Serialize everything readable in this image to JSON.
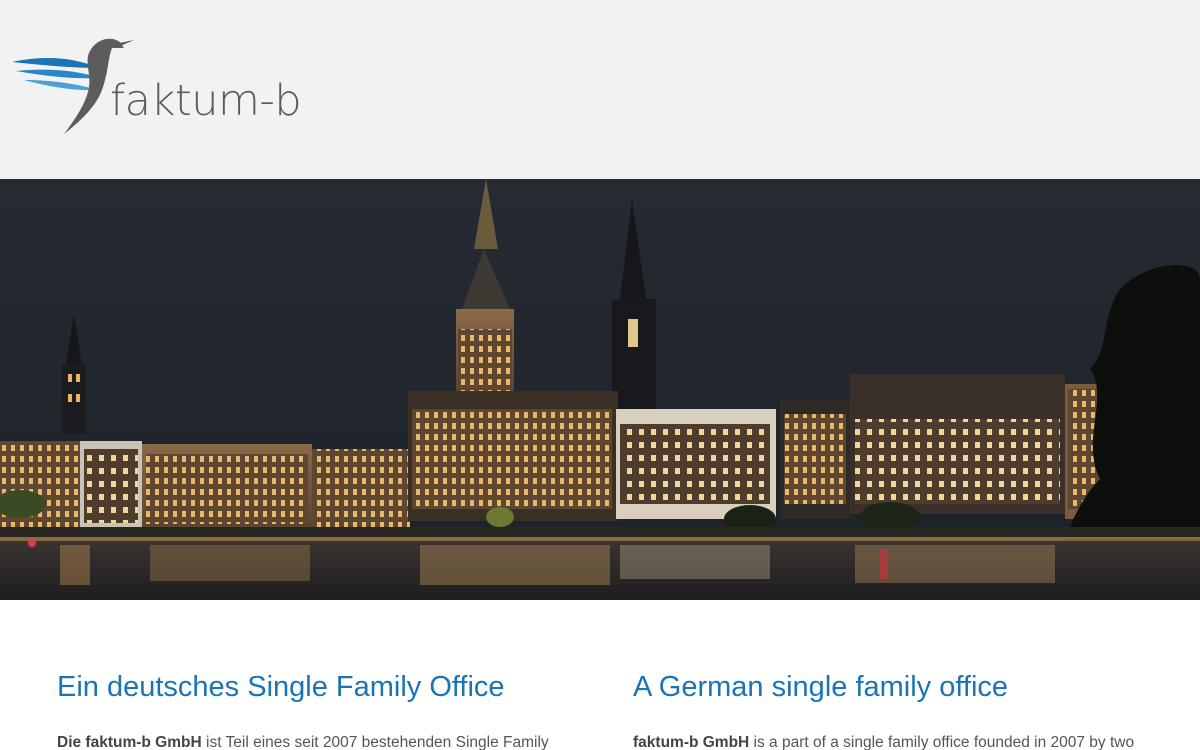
{
  "header": {
    "logo": {
      "icon": "hummingbird-logo-icon",
      "text": "faktum-b",
      "colors": {
        "wing": "#1a74b5",
        "body": "#5c5c5c"
      }
    }
  },
  "hero": {
    "image": "hamburg-night-skyline-photo"
  },
  "content": {
    "left": {
      "heading": "Ein deutsches Single Family Office",
      "text_bold": "Die faktum-b GmbH",
      "text": " ist Teil eines seit 2007 bestehenden Single Family"
    },
    "right": {
      "heading": "A German single family office",
      "text_bold": "faktum-b GmbH",
      "text": " is a part of a single family office founded in 2007 by two"
    }
  },
  "colors": {
    "accent": "#1a74b5",
    "header_bg": "#f2f2f2",
    "body_text": "#555555"
  }
}
